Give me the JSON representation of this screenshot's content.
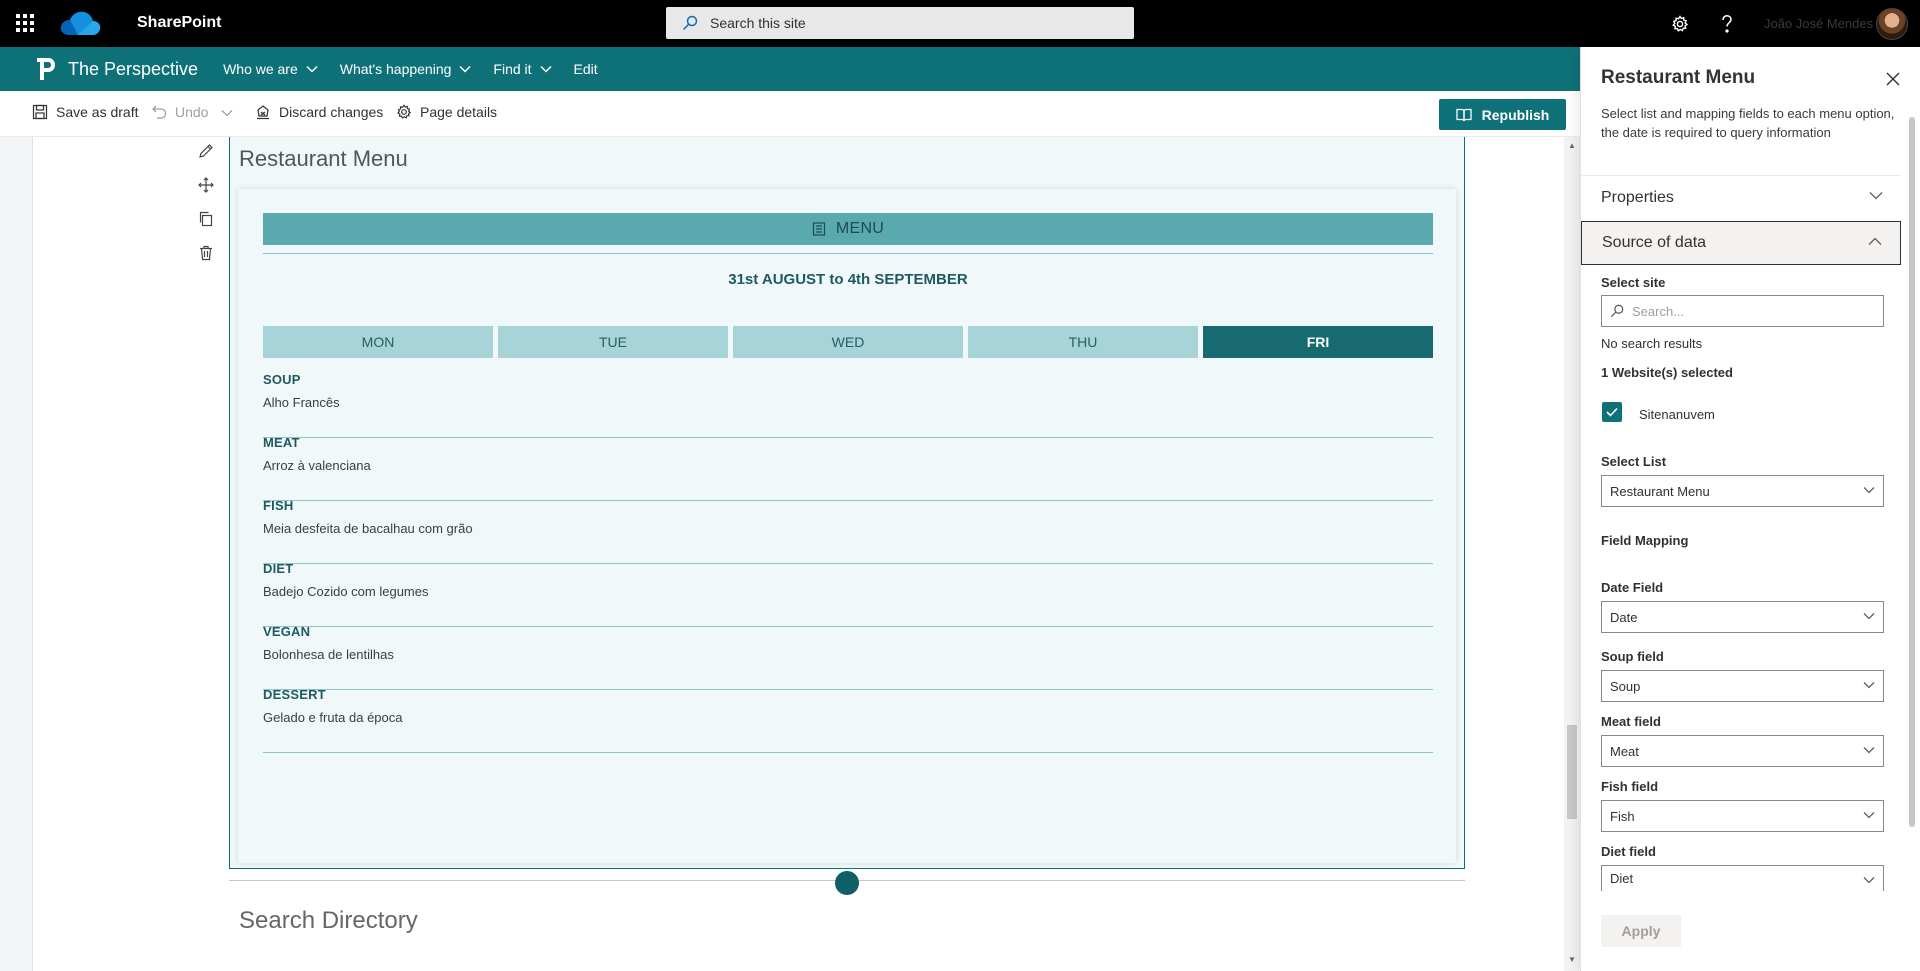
{
  "suite": {
    "app_name": "SharePoint",
    "search_placeholder": "Search this site",
    "user_name": "João José Mendes"
  },
  "site": {
    "title": "The Perspective",
    "nav": [
      {
        "label": "Who we are",
        "has_dropdown": true
      },
      {
        "label": "What's happening",
        "has_dropdown": true
      },
      {
        "label": "Find it",
        "has_dropdown": true
      },
      {
        "label": "Edit",
        "has_dropdown": false
      }
    ]
  },
  "commands": {
    "save_draft": "Save as draft",
    "undo": "Undo",
    "discard": "Discard changes",
    "page_details": "Page details",
    "republish": "Republish"
  },
  "webpart": {
    "title": "Restaurant Menu",
    "header": "MENU",
    "week": "31st AUGUST to 4th SEPTEMBER",
    "days": [
      {
        "label": "MON",
        "active": false
      },
      {
        "label": "TUE",
        "active": false
      },
      {
        "label": "WED",
        "active": false
      },
      {
        "label": "THU",
        "active": false
      },
      {
        "label": "FRI",
        "active": true
      }
    ],
    "courses": [
      {
        "category": "SOUP",
        "dish": "Alho Francês"
      },
      {
        "category": "MEAT",
        "dish": "Arroz à valenciana"
      },
      {
        "category": "FISH",
        "dish": "Meia desfeita de bacalhau com grão"
      },
      {
        "category": "DIET",
        "dish": "Badejo Cozido com legumes"
      },
      {
        "category": "VEGAN",
        "dish": "Bolonhesa de lentilhas"
      },
      {
        "category": "DESSERT",
        "dish": "Gelado e fruta da época"
      }
    ]
  },
  "next_section_title": "Search Directory",
  "pane": {
    "title": "Restaurant Menu",
    "description": "Select list and mapping fields to each menu option, the date is required to query information",
    "groups": {
      "properties": "Properties",
      "source": "Source of data"
    },
    "select_site_label": "Select site",
    "site_search_placeholder": "Search...",
    "no_results": "No search results",
    "selected_count": "1 Website(s) selected",
    "selected_site": "Sitenanuvem",
    "select_list_label": "Select List",
    "select_list_value": "Restaurant Menu",
    "field_mapping_label": "Field Mapping",
    "fields": [
      {
        "label": "Date Field",
        "value": "Date"
      },
      {
        "label": "Soup field",
        "value": "Soup"
      },
      {
        "label": "Meat field",
        "value": "Meat"
      },
      {
        "label": "Fish field",
        "value": "Fish"
      },
      {
        "label": "Diet field",
        "value": "Diet"
      }
    ],
    "apply": "Apply"
  },
  "colors": {
    "brand_teal": "#0f7178",
    "menu_header": "#5aa9ae",
    "day_tab": "#a6d4d8",
    "day_tab_active": "#176a70",
    "webpart_bg": "#f0f8f9"
  },
  "icons": [
    "waffle-icon",
    "onedrive-logo-icon",
    "search-icon",
    "settings-icon",
    "help-icon",
    "chevron-down-icon",
    "save-icon",
    "undo-icon",
    "discard-icon",
    "gear-icon",
    "book-icon",
    "edit-icon",
    "move-icon",
    "duplicate-icon",
    "delete-icon",
    "list-icon",
    "close-icon",
    "chevron-up-icon",
    "checkmark-icon"
  ]
}
